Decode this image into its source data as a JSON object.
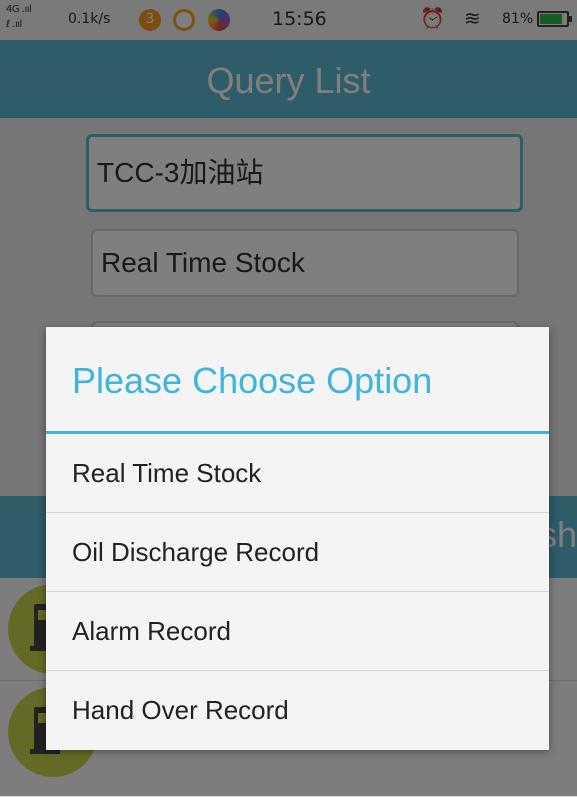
{
  "status_bar": {
    "network": "4G",
    "speed": "0.1k/s",
    "time": "15:56",
    "battery": "81%",
    "battery_level": 0.81,
    "app_icons": [
      "notification-badge-icon",
      "app-icon",
      "app-icon"
    ],
    "badge_count": "3"
  },
  "header": {
    "title": "Query List"
  },
  "form": {
    "station_value": "TCC-3加油站",
    "query_type_value": "Real Time Stock"
  },
  "background_band_text": "sh",
  "dialog": {
    "title": "Please Choose Option",
    "options": [
      "Real Time Stock",
      "Oil Discharge Record",
      "Alarm Record",
      "Hand Over Record"
    ]
  },
  "colors": {
    "accent": "#3fb4dd",
    "header_bg": "#5fb8d3",
    "pump_badge": "#c9d44a"
  }
}
